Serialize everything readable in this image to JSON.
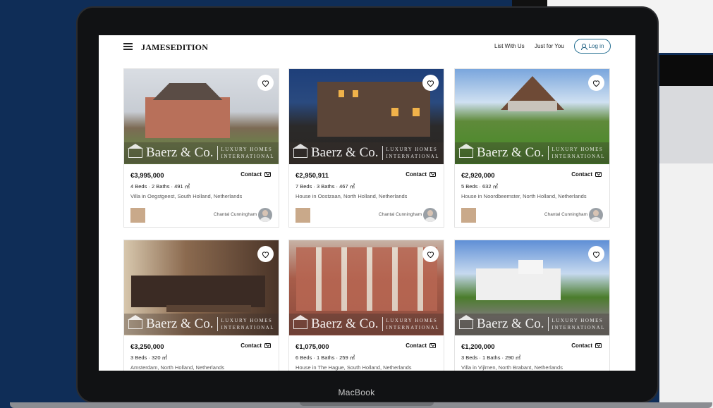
{
  "header": {
    "logo": "JAMESEDITION",
    "links": [
      "List With Us",
      "Just for You"
    ],
    "login_label": "Log in"
  },
  "device": {
    "brand": "MacBook"
  },
  "watermark": {
    "name": "Baerz & Co.",
    "tag1": "LUXURY HOMES",
    "tag2": "INTERNATIONAL"
  },
  "contact_label": "Contact",
  "listings": [
    {
      "price": "€3,995,000",
      "specs": "4 Beds · 2 Baths · 491 ㎡",
      "address": "Villa in Oegstgeest, South Holland, Netherlands",
      "agent": "Chantal Cunningham"
    },
    {
      "price": "€2,950,911",
      "specs": "7 Beds · 3 Baths · 467 ㎡",
      "address": "House in Oostzaan, North Holland, Netherlands",
      "agent": "Chantal Cunningham"
    },
    {
      "price": "€2,920,000",
      "specs": "5 Beds · 632 ㎡",
      "address": "House in Noordbeemster, North Holland, Netherlands",
      "agent": "Chantal Cunningham"
    },
    {
      "price": "€3,250,000",
      "specs": "3 Beds · 320 ㎡",
      "address": "Amsterdam, North Holland, Netherlands",
      "agent": ""
    },
    {
      "price": "€1,075,000",
      "specs": "6 Beds · 1 Baths · 259 ㎡",
      "address": "House in The Hague, South Holland, Netherlands",
      "agent": ""
    },
    {
      "price": "€1,200,000",
      "specs": "3 Beds · 1 Baths · 290 ㎡",
      "address": "Villa in Vijlmen, North Brabant, Netherlands",
      "agent": ""
    }
  ]
}
